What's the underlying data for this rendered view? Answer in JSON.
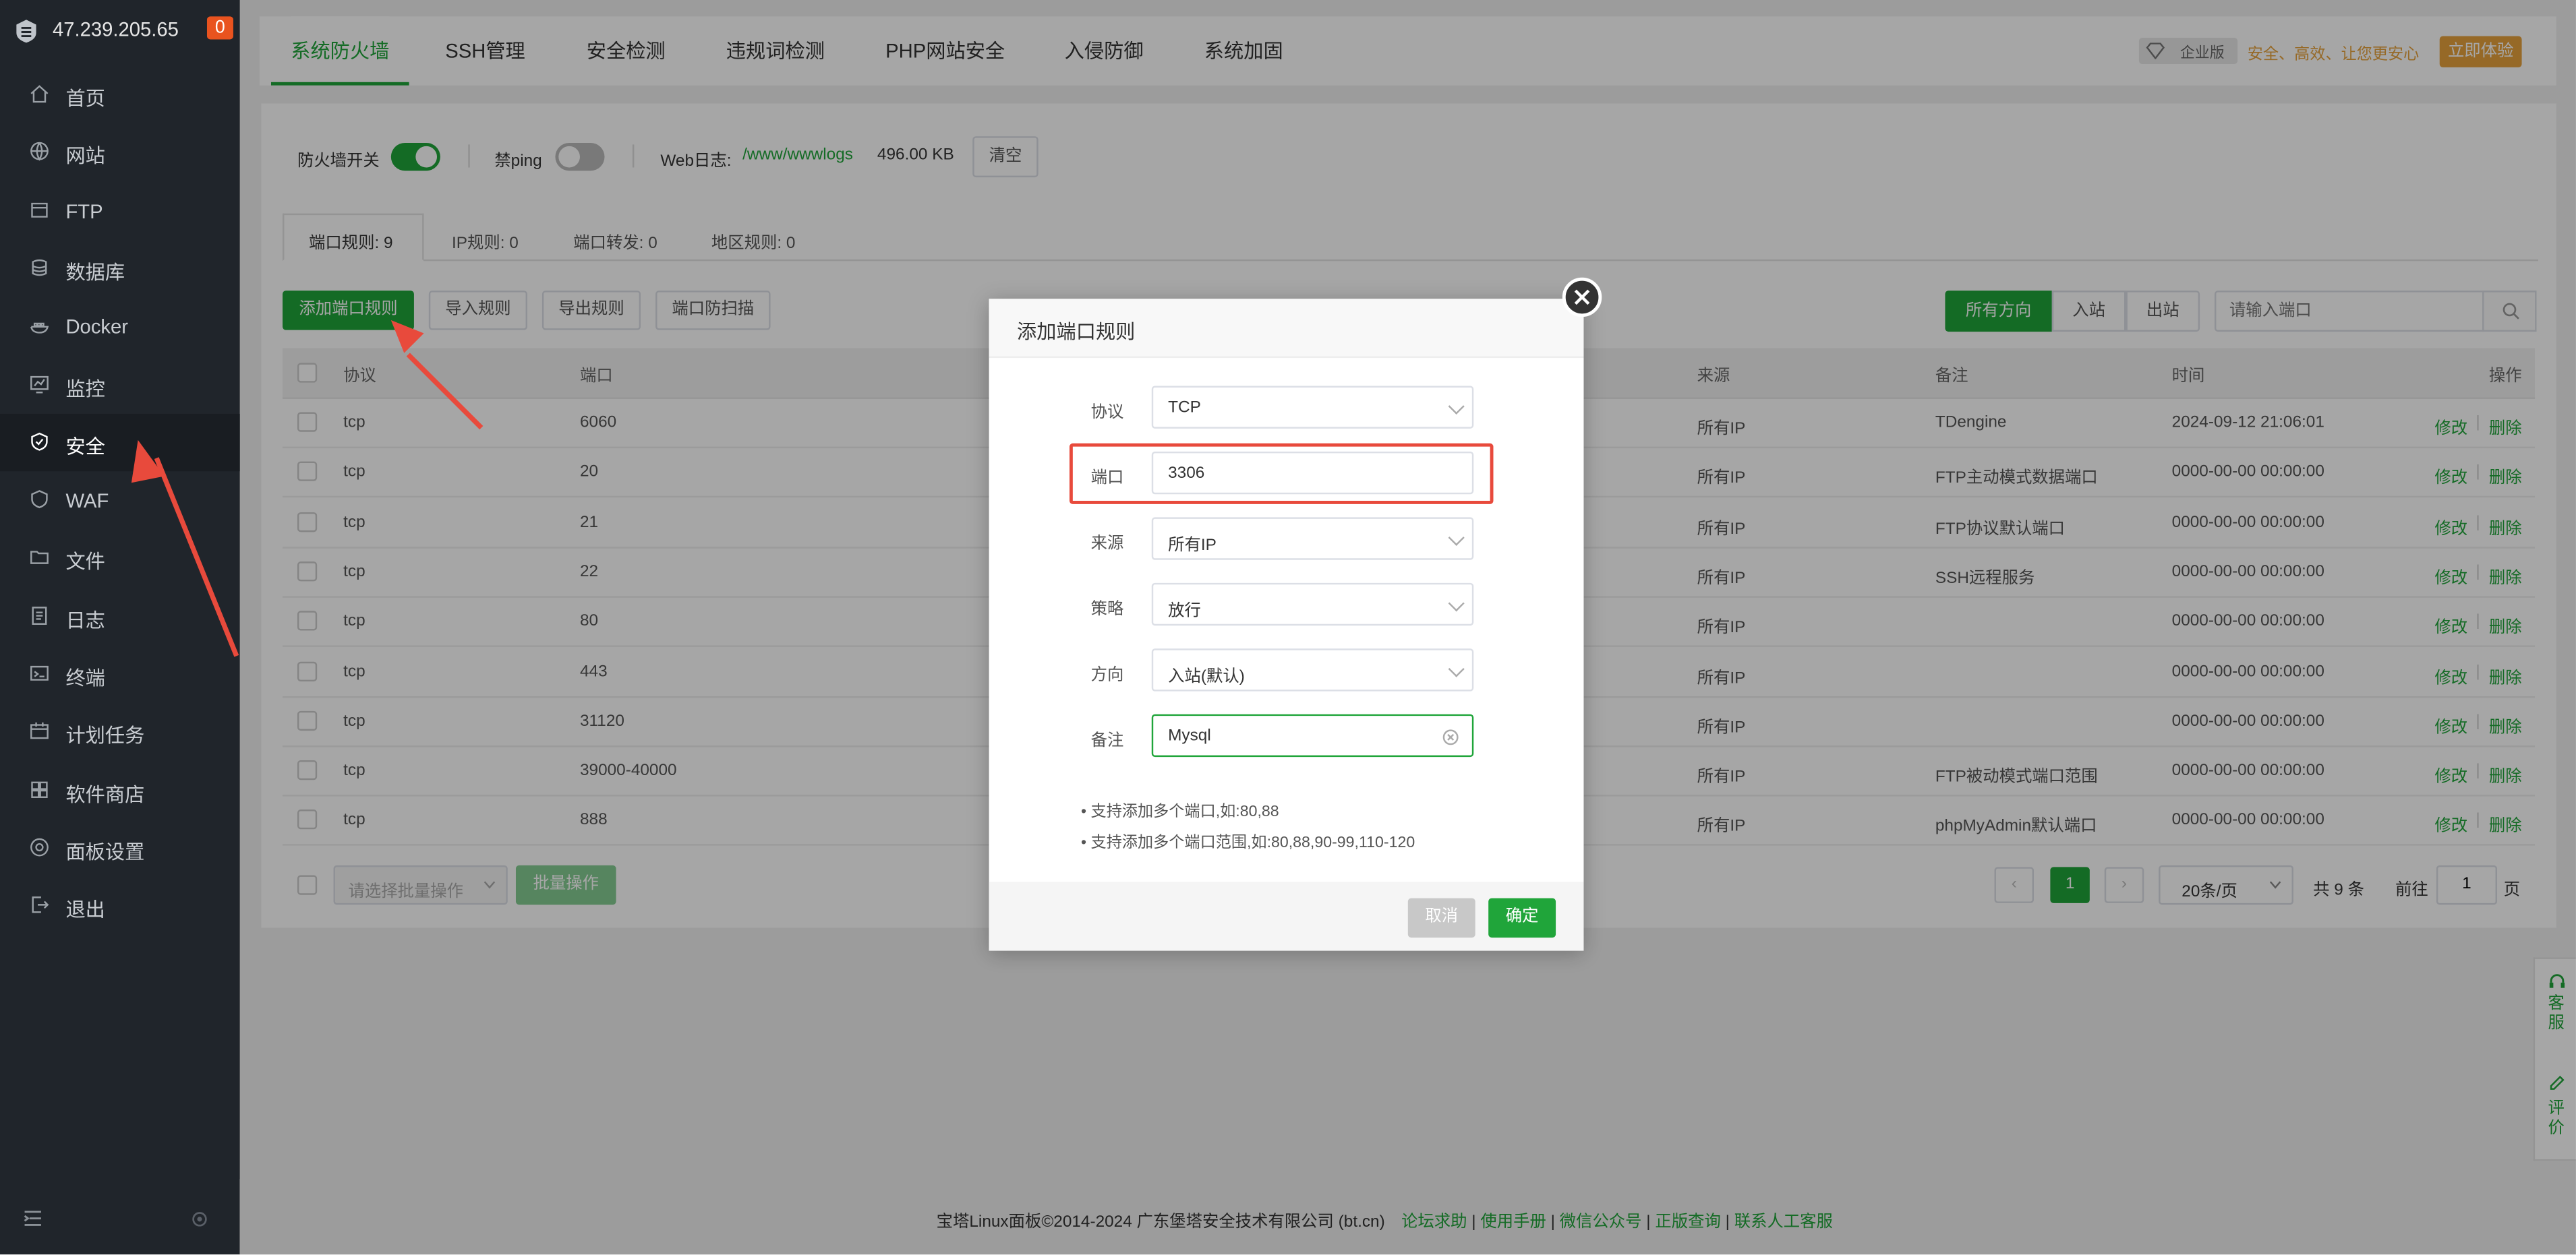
{
  "sidebar": {
    "ip": "47.239.205.65",
    "badge": "0",
    "items": [
      {
        "label": "首页",
        "icon": "home-icon"
      },
      {
        "label": "网站",
        "icon": "globe-icon"
      },
      {
        "label": "FTP",
        "icon": "ftp-icon"
      },
      {
        "label": "数据库",
        "icon": "database-icon"
      },
      {
        "label": "Docker",
        "icon": "docker-icon"
      },
      {
        "label": "监控",
        "icon": "monitor-icon"
      },
      {
        "label": "安全",
        "icon": "shield-icon"
      },
      {
        "label": "WAF",
        "icon": "waf-icon"
      },
      {
        "label": "文件",
        "icon": "folder-icon"
      },
      {
        "label": "日志",
        "icon": "log-icon"
      },
      {
        "label": "终端",
        "icon": "terminal-icon"
      },
      {
        "label": "计划任务",
        "icon": "calendar-icon"
      },
      {
        "label": "软件商店",
        "icon": "store-icon"
      },
      {
        "label": "面板设置",
        "icon": "settings-icon"
      },
      {
        "label": "退出",
        "icon": "logout-icon"
      }
    ]
  },
  "topnav": {
    "tabs": [
      "系统防火墙",
      "SSH管理",
      "安全检测",
      "违规词检测",
      "PHP网站安全",
      "入侵防御",
      "系统加固"
    ],
    "enterprise_badge": "企业版",
    "slogan": "安全、高效、让您更安心",
    "trial_button": "立即体验"
  },
  "toolbar": {
    "firewall_label": "防火墙开关",
    "ping_label": "禁ping",
    "weblog_label": "Web日志:",
    "weblog_path": "/www/wwwlogs",
    "weblog_size": "496.00 KB",
    "clear_button": "清空"
  },
  "subtabs": [
    "端口规则: 9",
    "IP规则: 0",
    "端口转发: 0",
    "地区规则: 0"
  ],
  "actions": {
    "add": "添加端口规则",
    "import": "导入规则",
    "export": "导出规则",
    "scan": "端口防扫描",
    "dir_all": "所有方向",
    "dir_in": "入站",
    "dir_out": "出站",
    "search_placeholder": "请输入端口"
  },
  "table": {
    "headers": {
      "protocol": "协议",
      "port": "端口",
      "source": "来源",
      "note": "备注",
      "time": "时间",
      "ops": "操作"
    },
    "edit": "修改",
    "delete": "删除",
    "rows": [
      {
        "protocol": "tcp",
        "port": "6060",
        "source": "所有IP",
        "note": "TDengine",
        "time": "2024-09-12 21:06:01"
      },
      {
        "protocol": "tcp",
        "port": "20",
        "source": "所有IP",
        "note": "FTP主动模式数据端口",
        "time": "0000-00-00 00:00:00"
      },
      {
        "protocol": "tcp",
        "port": "21",
        "source": "所有IP",
        "note": "FTP协议默认端口",
        "time": "0000-00-00 00:00:00"
      },
      {
        "protocol": "tcp",
        "port": "22",
        "source": "所有IP",
        "note": "SSH远程服务",
        "time": "0000-00-00 00:00:00"
      },
      {
        "protocol": "tcp",
        "port": "80",
        "source": "所有IP",
        "note": "",
        "time": "0000-00-00 00:00:00"
      },
      {
        "protocol": "tcp",
        "port": "443",
        "source": "所有IP",
        "note": "",
        "time": "0000-00-00 00:00:00"
      },
      {
        "protocol": "tcp",
        "port": "31120",
        "source": "所有IP",
        "note": "",
        "time": "0000-00-00 00:00:00"
      },
      {
        "protocol": "tcp",
        "port": "39000-40000",
        "source": "所有IP",
        "note": "FTP被动模式端口范围",
        "time": "0000-00-00 00:00:00"
      },
      {
        "protocol": "tcp",
        "port": "888",
        "source": "所有IP",
        "note": "phpMyAdmin默认端口",
        "time": "0000-00-00 00:00:00"
      }
    ]
  },
  "bottom": {
    "batch_placeholder": "请选择批量操作",
    "batch_button": "批量操作",
    "page": "1",
    "per_page": "20条/页",
    "total": "共 9 条",
    "goto": "前往",
    "goto_page": "1",
    "page_unit": "页"
  },
  "right_float": {
    "service": "客服",
    "review": "评价"
  },
  "footer": {
    "copyright": "宝塔Linux面板©2014-2024 广东堡塔安全技术有限公司 (bt.cn)",
    "links": [
      "论坛求助",
      "使用手册",
      "微信公众号",
      "正版查询",
      "联系人工客服"
    ]
  },
  "dialog": {
    "title": "添加端口规则",
    "fields": {
      "protocol": {
        "label": "协议",
        "value": "TCP"
      },
      "port": {
        "label": "端口",
        "value": "3306"
      },
      "source": {
        "label": "来源",
        "value": "所有IP"
      },
      "strategy": {
        "label": "策略",
        "value": "放行"
      },
      "direction": {
        "label": "方向",
        "value": "入站(默认)"
      },
      "note": {
        "label": "备注",
        "value": "Mysql"
      }
    },
    "tips": [
      "支持添加多个端口,如:80,88",
      "支持添加多个端口范围,如:80,88,90-99,110-120"
    ],
    "cancel": "取消",
    "confirm": "确定"
  },
  "colors": {
    "accent": "#20a53a",
    "sidebar": "#20252b",
    "highlight": "#e84a3c"
  }
}
